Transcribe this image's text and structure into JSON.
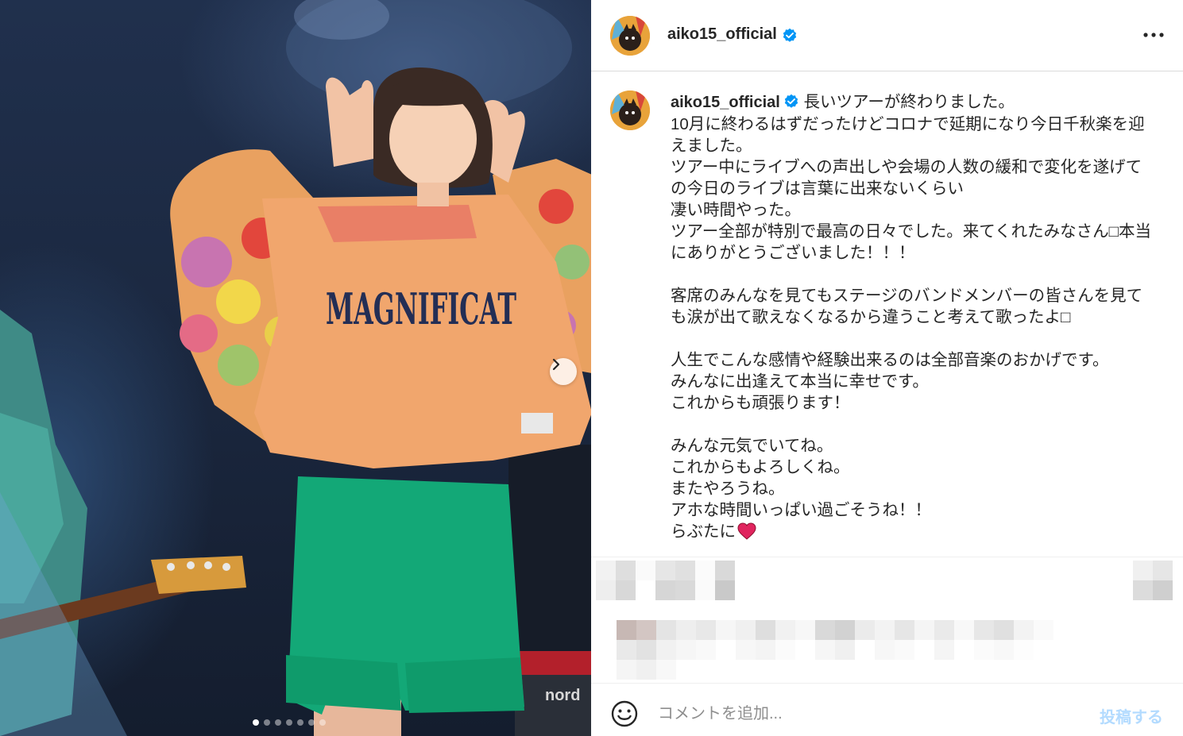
{
  "post": {
    "username": "aiko15_official",
    "caption": "長いツアーが終わりました。\n10月に終わるはずだったけどコロナで延期になり今日千秋楽を迎えました。\nツアー中にライブへの声出しや会場の人数の緩和で変化を遂げての今日のライブは言葉に出来ないくらい\n凄い時間やった。\nツアー全部が特別で最高の日々でした。来てくれたみなさん□本当にありがとうございました！！！\n\n客席のみんなを見てもステージのバンドメンバーの皆さんを見ても涙が出て歌えなくなるから違うこと考えて歌ったよ□\n\n人生でこんな感情や経験出来るのは全部音楽のおかげです。\nみんなに出逢えて本当に幸せです。\nこれからも頑張ります！\n\nみんな元気でいてね。\nこれからもよろしくね。\nまたやろうね。\nアホな時間いっぱい過ごそうね！！\nらぶたに",
    "shirt_text": "MAGNIFICAT",
    "keyboard_brand": "nord"
  },
  "carousel": {
    "count": 7,
    "active": 0
  },
  "comment_bar": {
    "placeholder": "コメントを追加...",
    "post_label": "投稿する"
  },
  "icons": {
    "verified": "verified-badge-icon",
    "more": "more-options-icon",
    "next": "chevron-right-icon",
    "emoji": "emoji-icon",
    "heart": "red-heart-icon"
  },
  "colors": {
    "verified": "#0095f6",
    "post_disabled": "#b3dbff",
    "heart": "#e0245e"
  }
}
